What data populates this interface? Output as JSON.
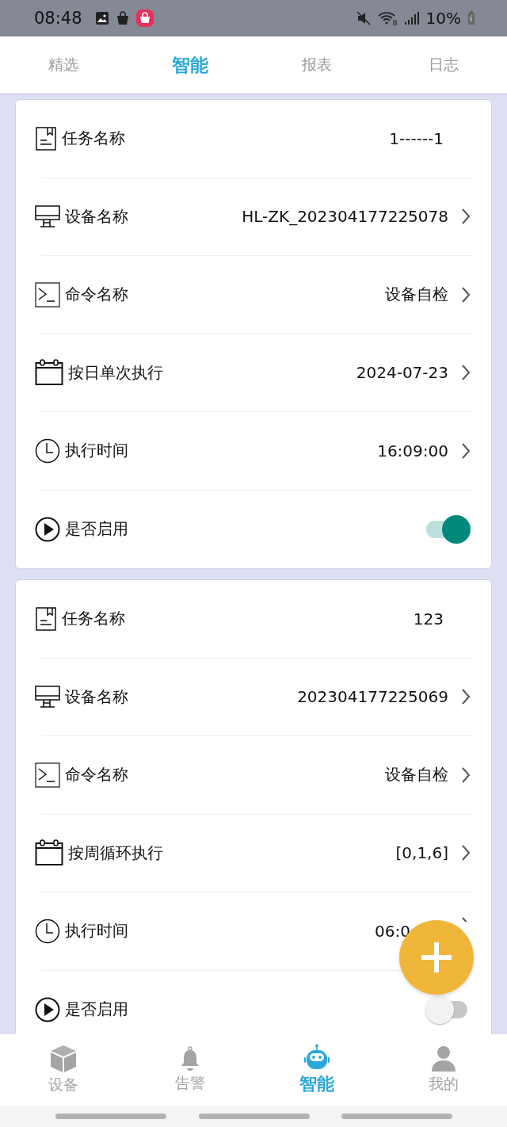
{
  "status_bar": {
    "time": "08:48",
    "battery": "10%"
  },
  "tabs": [
    {
      "label": "精选",
      "selected": false
    },
    {
      "label": "智能",
      "selected": true
    },
    {
      "label": "报表",
      "selected": false
    },
    {
      "label": "日志",
      "selected": false
    }
  ],
  "tasks": [
    {
      "rows": [
        {
          "kind": "text",
          "label": "任务名称",
          "value": "1------1"
        },
        {
          "kind": "link",
          "label": "设备名称",
          "value": "HL-ZK_202304177225078"
        },
        {
          "kind": "link",
          "label": "命令名称",
          "value": "设备自检"
        },
        {
          "kind": "link",
          "label": "按日单次执行",
          "value": "2024-07-23"
        },
        {
          "kind": "link",
          "label": "执行时间",
          "value": "16:09:00"
        },
        {
          "kind": "toggle",
          "label": "是否启用",
          "on": true
        }
      ]
    },
    {
      "rows": [
        {
          "kind": "text",
          "label": "任务名称",
          "value": "123"
        },
        {
          "kind": "link",
          "label": "设备名称",
          "value": "202304177225069"
        },
        {
          "kind": "link",
          "label": "命令名称",
          "value": "设备自检"
        },
        {
          "kind": "link",
          "label": "按周循环执行",
          "value": "[0,1,6]"
        },
        {
          "kind": "link",
          "label": "执行时间",
          "value": "06:0"
        },
        {
          "kind": "toggle",
          "label": "是否启用",
          "on": false
        }
      ]
    }
  ],
  "bottom_nav": [
    {
      "label": "设备",
      "selected": false
    },
    {
      "label": "告警",
      "selected": false
    },
    {
      "label": "智能",
      "selected": true
    },
    {
      "label": "我的",
      "selected": false
    }
  ]
}
